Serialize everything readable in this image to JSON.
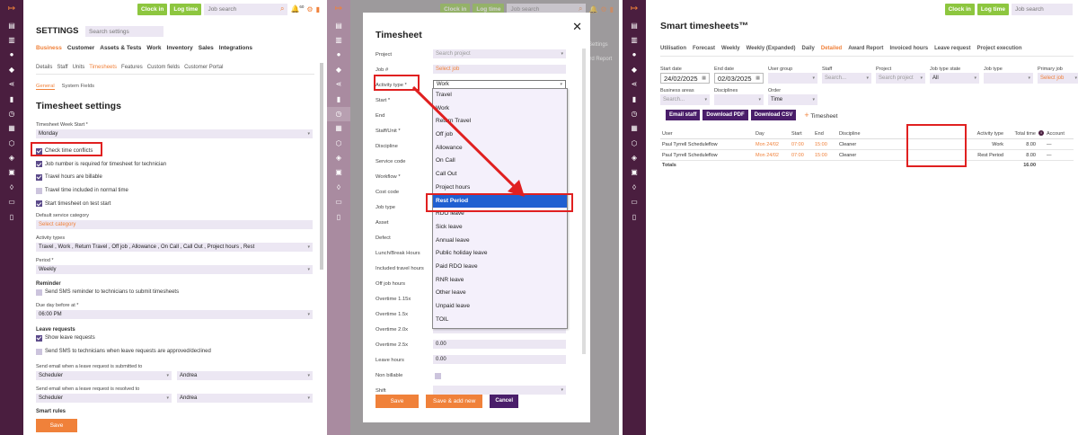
{
  "topbar": {
    "clock_in": "Clock in",
    "log_time": "Log time",
    "search_placeholder": "Job search",
    "notif_count": "60"
  },
  "p1": {
    "search_placeholder": "Search settings",
    "title": "SETTINGS",
    "main_tabs": [
      "Business",
      "Customer",
      "Assets & Tests",
      "Work",
      "Inventory",
      "Sales",
      "Integrations"
    ],
    "sub_tabs": [
      "Details",
      "Staff",
      "Units",
      "Timesheets",
      "Features",
      "Custom fields",
      "Customer Portal"
    ],
    "sec_tabs": [
      "General",
      "System Fields"
    ],
    "heading": "Timesheet settings",
    "week_start_label": "Timesheet Week Start *",
    "week_start_value": "Monday",
    "checks": [
      {
        "label": "Check time conflicts",
        "on": true
      },
      {
        "label": "Job number is required for timesheet for technician",
        "on": true
      },
      {
        "label": "Travel hours are billable",
        "on": true
      },
      {
        "label": "Travel time included in normal time",
        "on": false
      },
      {
        "label": "Start timesheet on test start",
        "on": true
      }
    ],
    "default_cat_label": "Default service category",
    "default_cat_ph": "Select category",
    "activity_label": "Activity types",
    "activity_value": "Travel , Work , Return Travel , Off job , Allowance , On Call , Call Out , Project hours , Rest",
    "period_label": "Period *",
    "period_value": "Weekly",
    "reminder_head": "Reminder",
    "reminder_check": "Send SMS reminder to technicians to submit timesheets",
    "due_label": "Due day before at *",
    "due_value": "06:00 PM",
    "leave_head": "Leave requests",
    "leave_check1": "Show leave requests",
    "leave_check2": "Send SMS to technicians when leave requests are approved/declined",
    "submit_label": "Send email when a leave request is submitted to",
    "submit_v1": "Scheduler",
    "submit_v2": "Andrea",
    "resolved_label": "Send email when a leave request is resolved to",
    "resolved_v1": "Scheduler",
    "resolved_v2": "Andrea",
    "smart_head": "Smart rules",
    "save": "Save"
  },
  "p2": {
    "title": "Timesheet",
    "close": "✕",
    "fields": [
      {
        "label": "Project",
        "value": "Search project",
        "ph": true
      },
      {
        "label": "Job #",
        "value": "Select job",
        "ph": "o"
      },
      {
        "label": "Activity type *",
        "value": "Work"
      },
      {
        "label": "Start *",
        "value": ""
      },
      {
        "label": "End",
        "value": ""
      },
      {
        "label": "Staff/Unit *",
        "value": ""
      },
      {
        "label": "Discipline",
        "value": ""
      },
      {
        "label": "Service code",
        "value": ""
      },
      {
        "label": "Workflow *",
        "value": ""
      },
      {
        "label": "Cost code",
        "value": ""
      },
      {
        "label": "Job type",
        "value": ""
      },
      {
        "label": "Asset",
        "value": ""
      },
      {
        "label": "Defect",
        "value": ""
      },
      {
        "label": "Lunch/Break Hours",
        "value": ""
      },
      {
        "label": "Included travel hours",
        "value": ""
      },
      {
        "label": "Off job hours",
        "value": ""
      },
      {
        "label": "Overtime 1.15x",
        "value": ""
      },
      {
        "label": "Overtime 1.5x",
        "value": ""
      },
      {
        "label": "Overtime 2.0x",
        "value": ""
      },
      {
        "label": "Overtime 2.5x",
        "value": "0.00"
      },
      {
        "label": "Leave hours",
        "value": "0.00"
      },
      {
        "label": "Non billable",
        "value": ""
      },
      {
        "label": "Shift",
        "value": ""
      }
    ],
    "options": [
      "Travel",
      "Work",
      "Return Travel",
      "Off job",
      "Allowance",
      "On Call",
      "Call Out",
      "Project hours",
      "Rest Period",
      "RDO leave",
      "Sick leave",
      "Annual leave",
      "Public holiday leave",
      "Paid RDO leave",
      "RNR leave",
      "Other leave",
      "Unpaid leave",
      "TOIL"
    ],
    "selected_option": "Rest Period",
    "bg_settings": "Settings",
    "bg_report": "ard Report",
    "save": "Save",
    "save_add": "Save & add new",
    "cancel": "Cancel"
  },
  "p3": {
    "title": "Smart timesheets™",
    "tabs": [
      "Utilisation",
      "Forecast",
      "Weekly",
      "Weekly (Expanded)",
      "Daily",
      "Detailed",
      "Award Report",
      "Invoiced hours",
      "Leave request",
      "Project execution"
    ],
    "active_tab": "Detailed",
    "filters1": [
      {
        "label": "Start date",
        "value": "24/02/2025",
        "cal": true
      },
      {
        "label": "End date",
        "value": "02/03/2025",
        "cal": true
      },
      {
        "label": "User group",
        "value": ""
      },
      {
        "label": "Staff",
        "value": "Search..."
      },
      {
        "label": "Project",
        "value": "Search project"
      },
      {
        "label": "Job type state",
        "value": "All"
      },
      {
        "label": "Job type",
        "value": ""
      },
      {
        "label": "Primary job",
        "value": "Select job"
      }
    ],
    "filters2": [
      {
        "label": "Business areas",
        "value": "Search..."
      },
      {
        "label": "Disciplines",
        "value": ""
      },
      {
        "label": "Order",
        "value": "Time"
      }
    ],
    "buttons": [
      "Email staff",
      "Download PDF",
      "Download CSV"
    ],
    "add_timesheet": "Timesheet",
    "headers": [
      "User",
      "Day",
      "Start",
      "End",
      "Discipline",
      "Activity type",
      "Total time",
      "Account"
    ],
    "rows": [
      [
        "Paul Tyrrell Scheduleflow",
        "Mon 24/02",
        "07:00",
        "15:00",
        "Cleaner",
        "Work",
        "8.00",
        "—"
      ],
      [
        "Paul Tyrrell Scheduleflow",
        "Mon 24/02",
        "07:00",
        "15:00",
        "Cleaner",
        "Rest Period",
        "8.00",
        "—"
      ]
    ],
    "totals_label": "Totals",
    "totals_value": "16.00"
  }
}
